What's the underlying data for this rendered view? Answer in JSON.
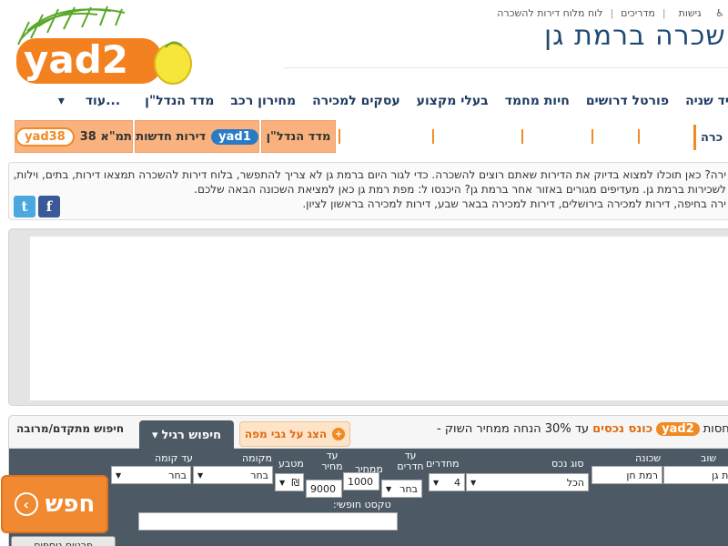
{
  "logo": {
    "text": "yad2"
  },
  "toplinks": [
    "גישות",
    "מדריכים",
    "לוח מלוח דירות להשכרה"
  ],
  "page_title": "שכרה  ברמת גן",
  "mainnav": [
    "יד שניה",
    "פורטל דרושים",
    "חיות מחמד",
    "בעלי מקצוע",
    "עסקים למכירה",
    "מחירון רכב",
    "מדד הנדל\"ן",
    "עוד..."
  ],
  "subnav": {
    "left_tab": {
      "badge": "yad38",
      "label": "תמ\"א 38"
    },
    "new_tab": {
      "badge": "yad1",
      "label": "דירות חדשות"
    },
    "index_tab": "מדד הנדל\"ן",
    "cut_label": "כרה"
  },
  "intro": {
    "lines": [
      "ירה? כאן תוכלו למצוא בדיוק את הדירות שאתם רוצים להשכרה. כדי לגור היום ברמת גן לא צריך להתפשר, בלוח דירות להשכרה תמצאו דירות, בתים, וילות,",
      "לשכירות ברמת גן. מעדיפים מגורים באזור אחר ברמת גן? היכנסו ל: מפת רמת גן כאן למציאת השכונה הבאה שלכם.",
      "ירה בחיפה, דירות למכירה בירושלים, דירות למכירה בבאר שבע, דירות למכירה בראשון לציון."
    ],
    "twitter_icon": "t",
    "facebook_icon": "f"
  },
  "search": {
    "tab_advanced": "חיפוש מתקדם/מרובה",
    "tab_regular": "חיפוש רגיל",
    "tab_map": "הצג על גבי מפה",
    "promo_prefix": "בחסות:",
    "promo_badge": "yad2",
    "promo_brand": "כונס נכסים",
    "promo_text": "- עד 30% הנחה ממחיר השוק",
    "labels": {
      "neighborhood": "שכונה",
      "city": "שוב",
      "type": "סוג נכס",
      "rooms_from": "מחדרים",
      "rooms_to": "עד חדרים",
      "price_from": "ממחיר",
      "price_to": "עד מחיר",
      "currency": "מטבע",
      "floor_from": "מקומה",
      "floor_to": "עד קומה",
      "free_text": "טקסט חופשי:"
    },
    "values": {
      "city": "רמת גן",
      "neighborhood": "רמת חן",
      "type": "הכל",
      "rooms_from": "4",
      "rooms_to": "בחר",
      "price_from": "1000",
      "price_to": "9000",
      "currency": "₪",
      "floor_from": "בחר",
      "floor_to": "בחר"
    },
    "go_label": "חפש",
    "adv_button": "פרטים נוספים"
  }
}
